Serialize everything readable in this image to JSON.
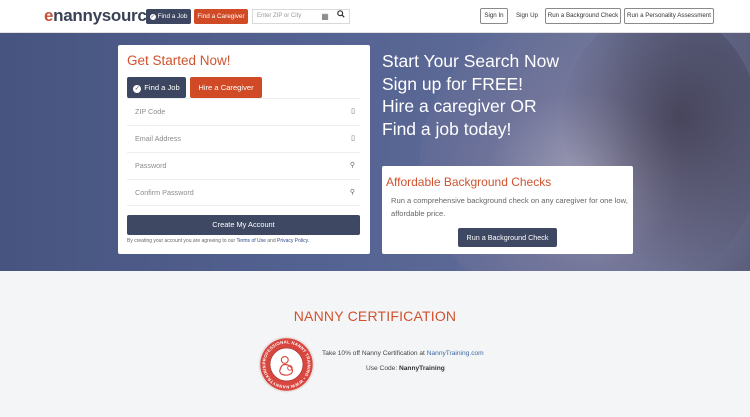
{
  "header": {
    "logo_e": "e",
    "logo_rest": "nannysource",
    "find_job": "Find a Job",
    "find_caregiver": "Find a Caregiver",
    "search_placeholder": "Enter ZIP or City",
    "sign_in": "Sign In",
    "sign_up": "Sign Up",
    "run_background_check": "Run a Background Check",
    "run_personality": "Run a Personality Assessment"
  },
  "form": {
    "title": "Get Started Now!",
    "tab_job": "Find a Job",
    "tab_caregiver": "Hire a Caregiver",
    "zip_placeholder": "ZIP Code",
    "email_placeholder": "Email Address",
    "password_placeholder": "Password",
    "confirm_placeholder": "Confirm Password",
    "create_button": "Create My Account",
    "terms_prefix": "By creating your account you are agreeing to our",
    "terms_link": "Terms of Use",
    "terms_and": "and",
    "privacy_link": "Privacy Policy."
  },
  "hero": {
    "lines": [
      "Start Your Search Now",
      "Sign up for FREE!",
      "Hire a caregiver OR",
      "Find a job today!"
    ]
  },
  "background_card": {
    "title": "Affordable Background Checks",
    "description": "Run a comprehensive background check on any caregiver for one low, affordable price.",
    "button": "Run a Background Check"
  },
  "certification": {
    "title": "NANNY CERTIFICATION",
    "text_prefix": "Take 10% off Nanny Certification at",
    "text_link": "NannyTraining.com",
    "code_prefix": "Use Code:",
    "code": "NannyTraining",
    "seal_text": "PROFESSIONAL NANNY TRAINING • WWW.NANNYTRAINING.COM •"
  },
  "colors": {
    "accent": "#d0532e",
    "navy": "#3f4863",
    "hero": "#4f5c8a"
  }
}
